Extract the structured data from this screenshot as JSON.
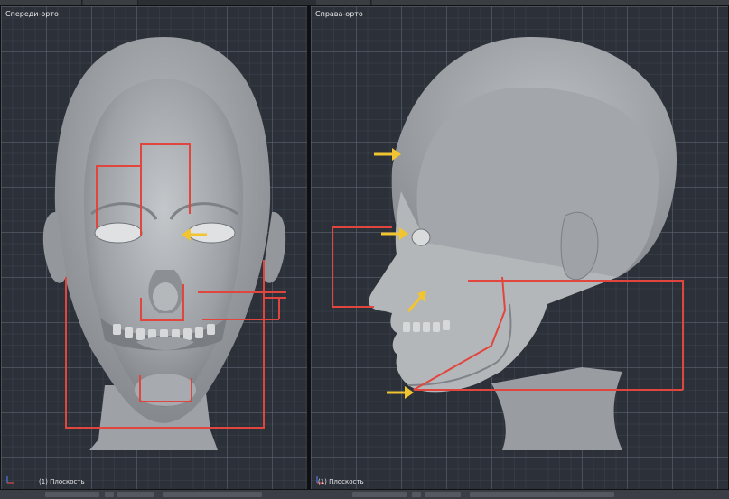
{
  "left_viewport": {
    "title": "Спереди-орто",
    "footer": "(1) Плоскость"
  },
  "right_viewport": {
    "title": "Справа-орто",
    "footer": "(1) Плоскость"
  },
  "colors": {
    "grid_bg": "#2b3039",
    "guide_line": "#e0453e",
    "arrow": "#f2c530",
    "model": "#a8acb0"
  },
  "icons": [
    "axis-icon",
    "arrow-icon"
  ]
}
